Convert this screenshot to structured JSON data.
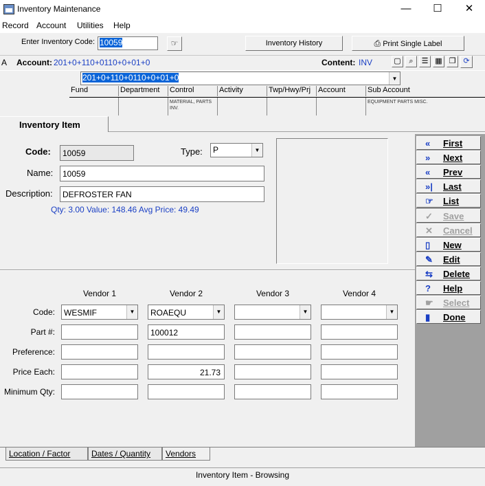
{
  "window": {
    "title": "Inventory Maintenance",
    "minimize": "—",
    "maximize": "☐",
    "close": "✕"
  },
  "menu": [
    "Record",
    "Account",
    "Utilities",
    "Help"
  ],
  "toolbar": {
    "enter_code_label": "Enter Inventory Code:",
    "enter_code_value": "10059",
    "history_button": "Inventory History",
    "print_button": "Print Single Label"
  },
  "account_bar": {
    "prefix": "A",
    "account_label": "Account:",
    "account_value": "201+0+110+0110+0+01+0",
    "content_label": "Content:",
    "content_value": "INV",
    "dropdown_value": "201+0+110+0110+0+01+0"
  },
  "segments": {
    "headers": [
      "Fund",
      "Department",
      "Control",
      "Activity",
      "Twp/Hwy/Prj",
      "Account",
      "Sub Account"
    ],
    "values": [
      "",
      "",
      "MATERIAL, PARTS INV.",
      "",
      "",
      "",
      "EQUIPMENT PARTS MISC."
    ]
  },
  "tab": {
    "label": "Inventory Item"
  },
  "item": {
    "code_label": "Code:",
    "code_value": "10059",
    "type_label": "Type:",
    "type_value": "P",
    "name_label": "Name:",
    "name_value": "10059",
    "desc_label": "Description:",
    "desc_value": "DEFROSTER FAN",
    "summary": "Qty: 3.00  Value: 148.46  Avg Price: 49.49"
  },
  "nav_buttons": [
    {
      "label": "First",
      "icon": "«",
      "enabled": true
    },
    {
      "label": "Next",
      "icon": "»",
      "enabled": true
    },
    {
      "label": "Prev",
      "icon": "«",
      "enabled": true
    },
    {
      "label": "Last",
      "icon": "»|",
      "enabled": true
    },
    {
      "label": "List",
      "icon": "☞",
      "enabled": true
    },
    {
      "label": "Save",
      "icon": "✓",
      "enabled": false
    },
    {
      "label": "Cancel",
      "icon": "✕",
      "enabled": false
    },
    {
      "label": "New",
      "icon": "▯",
      "enabled": true
    },
    {
      "label": "Edit",
      "icon": "✎",
      "enabled": true
    },
    {
      "label": "Delete",
      "icon": "⇆",
      "enabled": true
    },
    {
      "label": "Help",
      "icon": "?",
      "enabled": true
    },
    {
      "label": "Select",
      "icon": "☛",
      "enabled": false
    },
    {
      "label": "Done",
      "icon": "▮",
      "enabled": true
    }
  ],
  "vendors": {
    "headers": [
      "Vendor 1",
      "Vendor 2",
      "Vendor 3",
      "Vendor 4"
    ],
    "row_labels": [
      "Code:",
      "Part #:",
      "Preference:",
      "Price Each:",
      "Minimum Qty:"
    ],
    "code": [
      "WESMIF",
      "ROAEQU",
      "",
      ""
    ],
    "part": [
      "",
      "100012",
      "",
      ""
    ],
    "preference": [
      "",
      "",
      "",
      ""
    ],
    "price": [
      "",
      "21.73",
      "",
      ""
    ],
    "min_qty": [
      "",
      "",
      "",
      ""
    ]
  },
  "bottom_tabs": [
    "Location / Factor",
    "Dates / Quantity",
    "Vendors"
  ],
  "status": "Inventory Item - Browsing"
}
